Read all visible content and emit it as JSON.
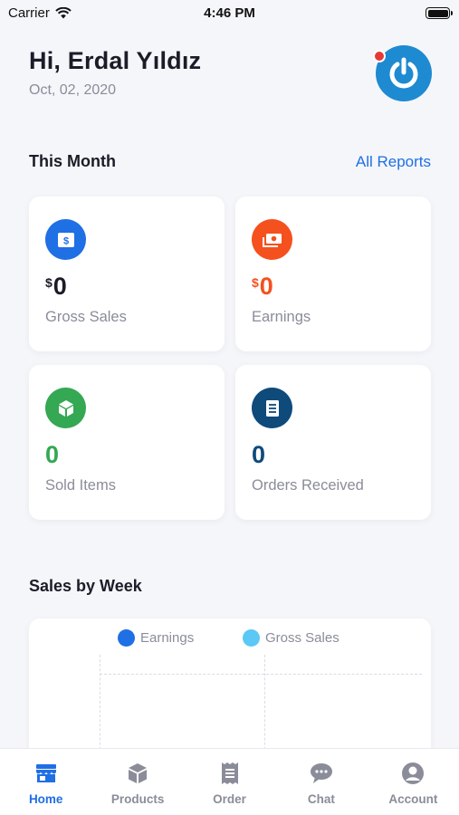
{
  "status_bar": {
    "carrier": "Carrier",
    "time": "4:46 PM"
  },
  "header": {
    "greeting": "Hi, Erdal Yıldız",
    "date": "Oct, 02, 2020",
    "avatar_icon": "power-icon"
  },
  "this_month": {
    "title": "This Month",
    "all_reports_label": "All Reports",
    "cards": [
      {
        "currency": "$",
        "value": "0",
        "label": "Gross Sales",
        "icon": "dollar-bill-icon",
        "icon_color": "#1f6fe5",
        "value_color": "#1c1c28"
      },
      {
        "currency": "$",
        "value": "0",
        "label": "Earnings",
        "icon": "money-stack-icon",
        "icon_color": "#f4511e",
        "value_color": "#f4511e"
      },
      {
        "value": "0",
        "label": "Sold Items",
        "icon": "box-icon",
        "icon_color": "#34a853",
        "value_color": "#34a853"
      },
      {
        "value": "0",
        "label": "Orders Received",
        "icon": "receipt-icon",
        "icon_color": "#0e4a7a",
        "value_color": "#0e4a7a"
      }
    ]
  },
  "sales_by_week": {
    "title": "Sales by Week",
    "legend": [
      {
        "label": "Earnings",
        "color": "#1f6fe5"
      },
      {
        "label": "Gross Sales",
        "color": "#5bc8f5"
      }
    ]
  },
  "tab_bar": {
    "tabs": [
      {
        "label": "Home",
        "icon": "store-icon",
        "active": true
      },
      {
        "label": "Products",
        "icon": "cube-icon",
        "active": false
      },
      {
        "label": "Order",
        "icon": "receipt-icon",
        "active": false
      },
      {
        "label": "Chat",
        "icon": "chat-bubble-icon",
        "active": false
      },
      {
        "label": "Account",
        "icon": "account-icon",
        "active": false
      }
    ],
    "active_color": "#1f6fe5",
    "inactive_color": "#8a8d99"
  }
}
